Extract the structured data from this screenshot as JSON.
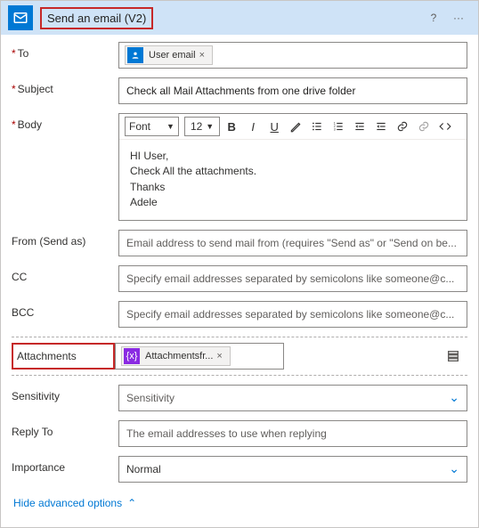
{
  "header": {
    "title": "Send an email (V2)",
    "help_glyph": "?",
    "more_glyph": "···"
  },
  "fields": {
    "to": {
      "label": "To",
      "token": "User email"
    },
    "subject": {
      "label": "Subject",
      "value": "Check all Mail Attachments from one drive folder"
    },
    "body": {
      "label": "Body",
      "font_label": "Font",
      "size_label": "12",
      "content": "HI User,\nCheck All the attachments.\nThanks\nAdele"
    },
    "from": {
      "label": "From (Send as)",
      "placeholder": "Email address to send mail from (requires \"Send as\" or \"Send on be..."
    },
    "cc": {
      "label": "CC",
      "placeholder": "Specify email addresses separated by semicolons like someone@c..."
    },
    "bcc": {
      "label": "BCC",
      "placeholder": "Specify email addresses separated by semicolons like someone@c..."
    },
    "attachments": {
      "label": "Attachments",
      "token": "Attachmentsfr..."
    },
    "sensitivity": {
      "label": "Sensitivity",
      "placeholder": "Sensitivity"
    },
    "replyto": {
      "label": "Reply To",
      "placeholder": "The email addresses to use when replying"
    },
    "importance": {
      "label": "Importance",
      "value": "Normal"
    }
  },
  "footer": {
    "advanced": "Hide advanced options"
  },
  "glyph": {
    "x": "×",
    "caret": "▼",
    "chev": "⌄",
    "up": "⌃"
  }
}
